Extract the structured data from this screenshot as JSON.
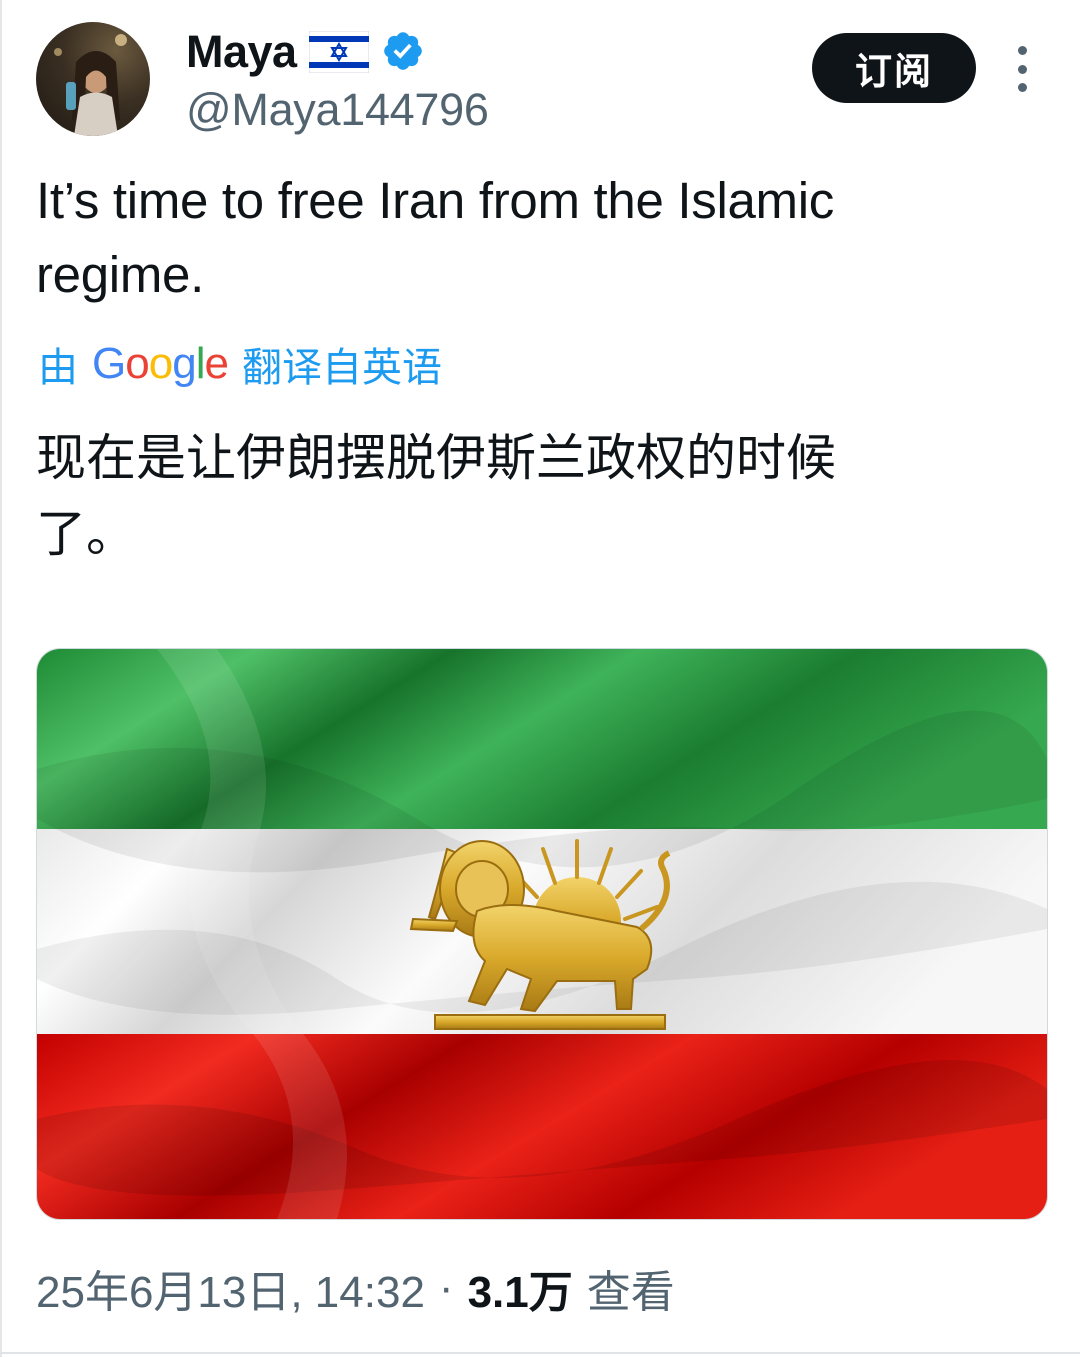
{
  "author": {
    "display_name": "Maya",
    "handle": "@Maya144796",
    "flag_icon": "israel-flag-icon",
    "verified_icon": "verified-badge-icon",
    "verified_color": "#1d9bf0"
  },
  "header": {
    "subscribe_label": "订阅",
    "more_icon": "more-vertical-icon"
  },
  "tweet": {
    "text_line_1": "It’s time to free Iran from the Islamic",
    "text_line_2": "regime.",
    "translation_prefix": "由",
    "translation_provider": "Google",
    "translation_suffix": "翻译自英语",
    "translated_line_1": "现在是让伊朗摆脱伊斯兰政权的时候",
    "translated_line_2": "了。"
  },
  "media": {
    "image": "iran-lion-and-sun-flag-image",
    "stripe_colors": [
      "#239f40",
      "#ffffff",
      "#da0000"
    ],
    "emblem_color": "#d9a92b"
  },
  "meta": {
    "timestamp": "25年6月13日, 14:32",
    "separator": "·",
    "views_count": "3.1万",
    "views_label": "查看"
  },
  "colors": {
    "text_primary": "#0f1419",
    "text_secondary": "#536471",
    "link": "#1d9bf0",
    "button_bg": "#0f1419"
  }
}
